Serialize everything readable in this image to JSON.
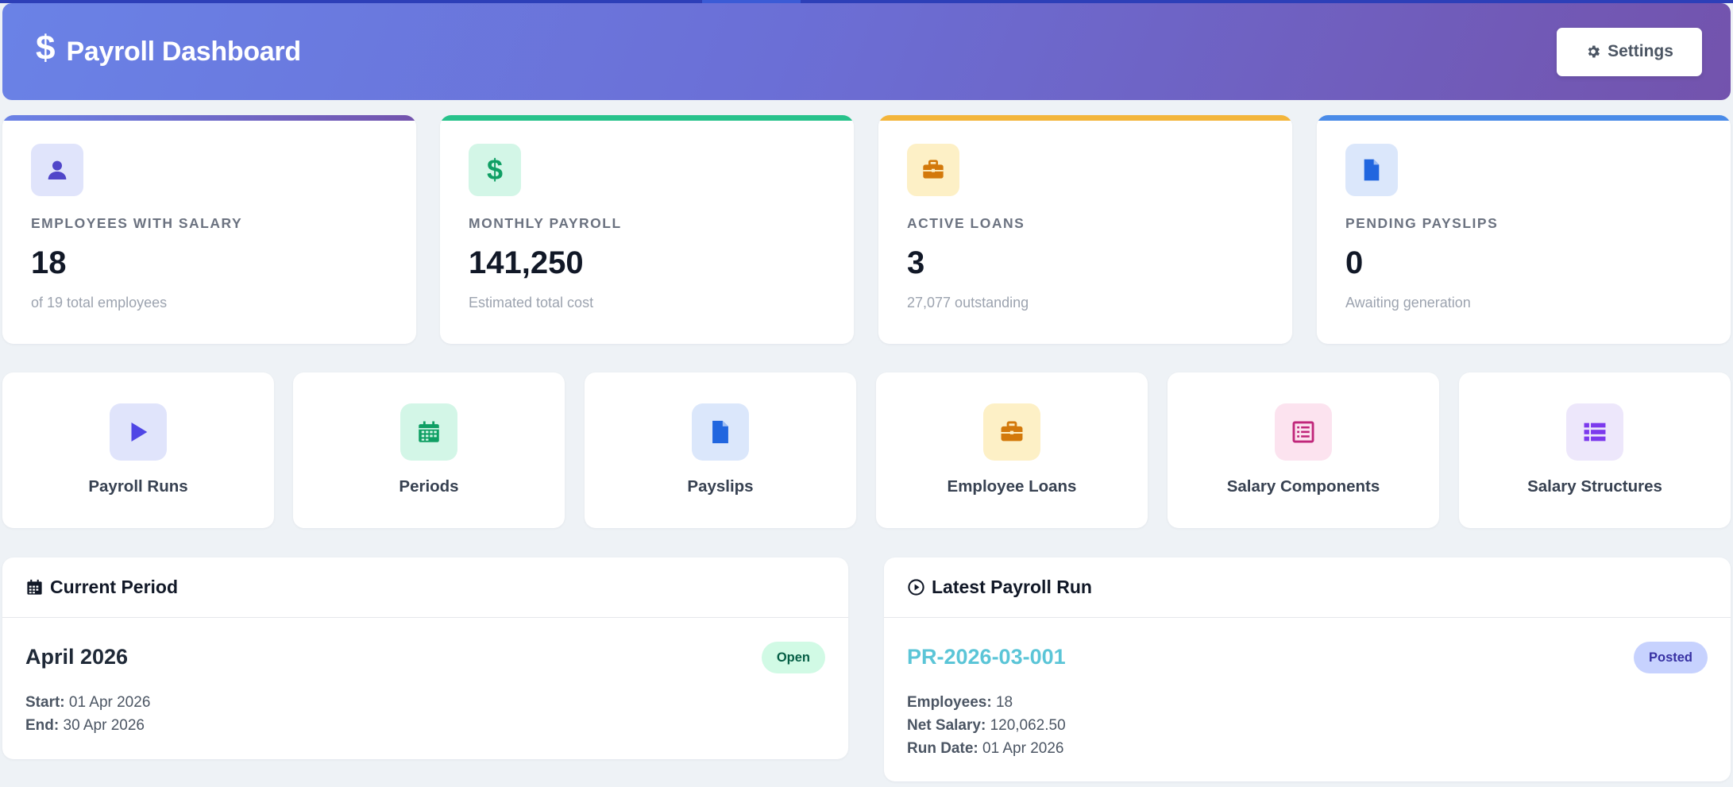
{
  "header": {
    "icon": "dollar-icon",
    "title": "Payroll Dashboard",
    "settings_label": "Settings",
    "gradient": [
      "#6a82e6",
      "#7353ad"
    ]
  },
  "stats": [
    {
      "label": "EMPLOYEES WITH SALARY",
      "value": "18",
      "sub": "of 19 total employees",
      "icon": "user-icon",
      "accent": "#7b6fd2"
    },
    {
      "label": "MONTHLY PAYROLL",
      "value": "141,250",
      "sub": "Estimated total cost",
      "icon": "dollar-icon",
      "accent": "#27c28b"
    },
    {
      "label": "ACTIVE LOANS",
      "value": "3",
      "sub": "27,077 outstanding",
      "icon": "briefcase-icon",
      "accent": "#f3b53b"
    },
    {
      "label": "PENDING PAYSLIPS",
      "value": "0",
      "sub": "Awaiting generation",
      "icon": "file-icon",
      "accent": "#4a8be8"
    }
  ],
  "quick_links": [
    {
      "label": "Payroll Runs",
      "icon": "play-icon"
    },
    {
      "label": "Periods",
      "icon": "calendar-icon"
    },
    {
      "label": "Payslips",
      "icon": "file-icon"
    },
    {
      "label": "Employee Loans",
      "icon": "briefcase-icon"
    },
    {
      "label": "Salary Components",
      "icon": "list-alt-icon"
    },
    {
      "label": "Salary Structures",
      "icon": "list-icon"
    }
  ],
  "current_period": {
    "heading": "Current Period",
    "name": "April 2026",
    "status": "Open",
    "start_label": "Start:",
    "start": "01 Apr 2026",
    "end_label": "End:",
    "end": "30 Apr 2026"
  },
  "latest_run": {
    "heading": "Latest Payroll Run",
    "id": "PR-2026-03-001",
    "status": "Posted",
    "employees_label": "Employees:",
    "employees": "18",
    "net_salary_label": "Net Salary:",
    "net_salary": "120,062.50",
    "run_date_label": "Run Date:",
    "run_date": "01 Apr 2026"
  }
}
